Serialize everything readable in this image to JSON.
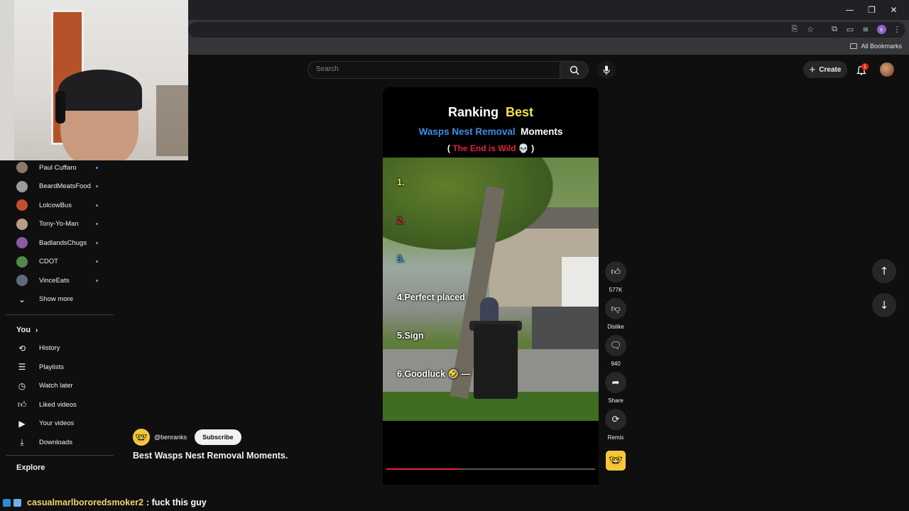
{
  "browser": {
    "window_controls": [
      "—",
      "❐",
      "✕"
    ],
    "bookmarks_label": "All Bookmarks",
    "profile_initial": "s"
  },
  "header": {
    "search_placeholder": "Search",
    "create_label": "Create",
    "notification_count": "1"
  },
  "sidebar": {
    "subscriptions": [
      {
        "name": "Paul Cuffaro",
        "color": "#8a7a6a"
      },
      {
        "name": "BeardMeatsFood",
        "color": "#9b9b9b"
      },
      {
        "name": "LolcowBus",
        "color": "#c0502e"
      },
      {
        "name": "Tony-Yo-Man",
        "color": "#b89c86"
      },
      {
        "name": "BadlandsChugs",
        "color": "#8a5aa0"
      },
      {
        "name": "CDOT",
        "color": "#4f8a4a"
      },
      {
        "name": "VinceEats",
        "color": "#5f6b7a"
      }
    ],
    "show_more": "Show more",
    "you_title": "You",
    "you_items": [
      {
        "label": "History",
        "icon": "history-icon"
      },
      {
        "label": "Playlists",
        "icon": "playlists-icon"
      },
      {
        "label": "Watch later",
        "icon": "clock-icon"
      },
      {
        "label": "Liked videos",
        "icon": "thumbs-up-icon"
      },
      {
        "label": "Your videos",
        "icon": "video-icon"
      },
      {
        "label": "Downloads",
        "icon": "download-icon"
      }
    ],
    "explore_title": "Explore"
  },
  "short": {
    "title_line1": [
      "Ranking",
      "Best"
    ],
    "title_line2": [
      "Wasps Nest Removal",
      "Moments"
    ],
    "title_line3": [
      "(",
      "The End is Wild 💀",
      ")"
    ],
    "ranks": [
      {
        "num": "1.",
        "text": "",
        "color": "yellow"
      },
      {
        "num": "2.",
        "text": "",
        "color": "red"
      },
      {
        "num": "3.",
        "text": "",
        "color": "blue"
      },
      {
        "num": "4.",
        "text": "Perfect placed",
        "color": "white"
      },
      {
        "num": "5.",
        "text": "Sign",
        "color": "white"
      },
      {
        "num": "6.",
        "text": "Goodluck 🤣 —",
        "color": "white"
      }
    ],
    "progress": 0.35,
    "channel": "@benranks",
    "subscribe_label": "Subscribe",
    "caption": "Best Wasps Nest Removal Moments."
  },
  "actions": {
    "like_count": "577K",
    "dislike_label": "Dislike",
    "comment_count": "940",
    "share_label": "Share",
    "remix_label": "Remix"
  },
  "chat": {
    "user": "casualmarlbororedsmoker2",
    "message": ": fuck this guy"
  }
}
